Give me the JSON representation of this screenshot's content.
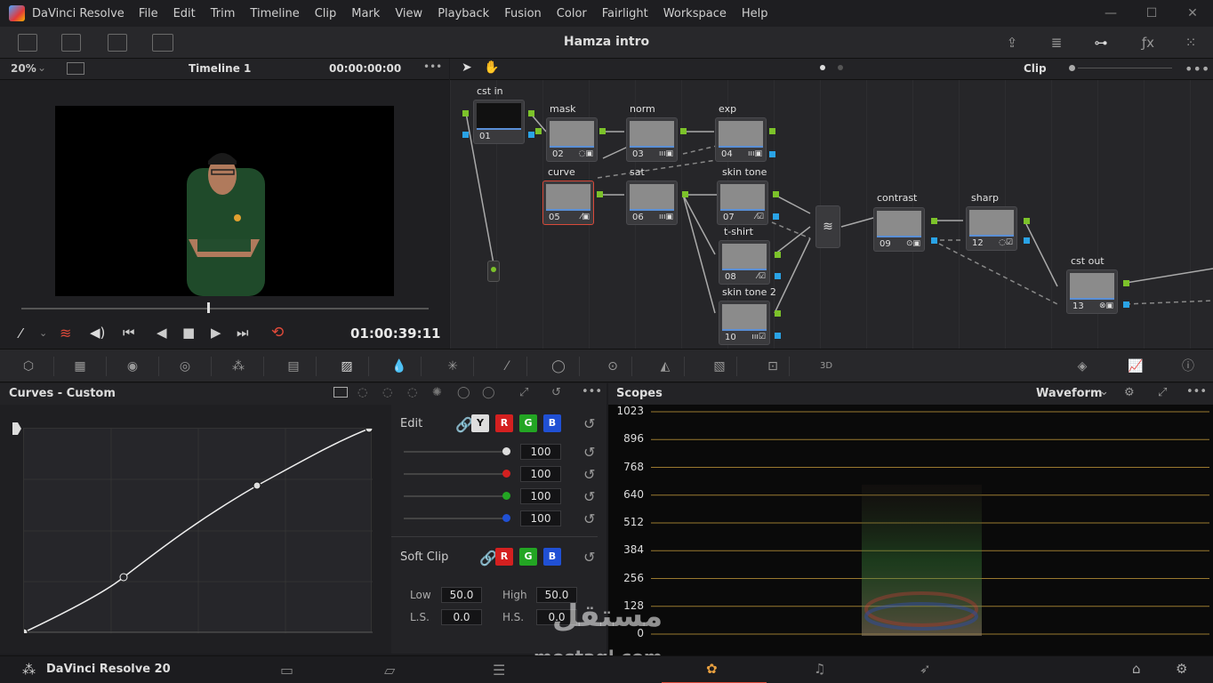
{
  "menubar": {
    "app_name": "DaVinci Resolve",
    "items": [
      "File",
      "Edit",
      "Trim",
      "Timeline",
      "Clip",
      "Mark",
      "View",
      "Playback",
      "Fusion",
      "Color",
      "Fairlight",
      "Workspace",
      "Help"
    ]
  },
  "toolbar": {
    "project_title": "Hamza intro"
  },
  "viewer": {
    "zoom": "20%",
    "timeline_name": "Timeline 1",
    "source_tc": "00:00:00:00",
    "playback_tc": "01:00:39:11"
  },
  "node_editor": {
    "mode": "Clip",
    "nodes": [
      {
        "label": "cst in",
        "num": "01"
      },
      {
        "label": "mask",
        "num": "02"
      },
      {
        "label": "norm",
        "num": "03"
      },
      {
        "label": "exp",
        "num": "04"
      },
      {
        "label": "curve",
        "num": "05"
      },
      {
        "label": "sat",
        "num": "06"
      },
      {
        "label": "skin tone",
        "num": "07"
      },
      {
        "label": "t-shirt",
        "num": "08"
      },
      {
        "label": "contrast",
        "num": "09"
      },
      {
        "label": "skin tone 2",
        "num": "10"
      },
      {
        "label": "sharp",
        "num": "12"
      },
      {
        "label": "cst out",
        "num": "13"
      }
    ]
  },
  "curves": {
    "title": "Curves - Custom",
    "edit_label": "Edit",
    "channels": [
      "Y",
      "R",
      "G",
      "B"
    ],
    "channel_values": [
      "100",
      "100",
      "100",
      "100"
    ],
    "soft_clip_label": "Soft Clip",
    "low_label": "Low",
    "low_value": "50.0",
    "high_label": "High",
    "high_value": "50.0",
    "ls_label": "L.S.",
    "ls_value": "0.0",
    "hs_label": "H.S.",
    "hs_value": "0.0"
  },
  "scopes": {
    "title": "Scopes",
    "type": "Waveform",
    "scale": [
      "1023",
      "896",
      "768",
      "640",
      "512",
      "384",
      "256",
      "128",
      "0"
    ]
  },
  "bottom": {
    "app_version": "DaVinci Resolve 20"
  },
  "watermark": {
    "text_ar": "مستقل",
    "text_en": "mostaql.com"
  }
}
